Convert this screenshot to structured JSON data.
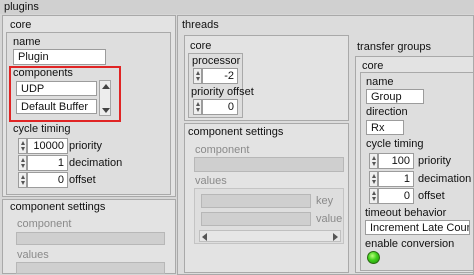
{
  "plugins": {
    "title": "plugins",
    "core": {
      "title": "core",
      "name_label": "name",
      "name_value": "Plugin",
      "components_label": "components",
      "components": [
        "UDP",
        "Default Buffer"
      ],
      "cycle_timing_label": "cycle timing",
      "priority_value": "10000",
      "priority_label": "priority",
      "decimation_value": "1",
      "decimation_label": "decimation",
      "offset_value": "0",
      "offset_label": "offset"
    },
    "component_settings": {
      "title": "component settings",
      "component_label": "component",
      "values_label": "values"
    }
  },
  "threads": {
    "title": "threads",
    "core": {
      "title": "core",
      "processor_label": "processor",
      "processor_value": "-2",
      "priority_offset_label": "priority offset",
      "priority_offset_value": "0"
    },
    "component_settings": {
      "title": "component settings",
      "component_label": "component",
      "values_label": "values",
      "key_label": "key",
      "value_label": "value"
    }
  },
  "transfer_groups": {
    "title": "transfer groups",
    "core": {
      "title": "core",
      "name_label": "name",
      "name_value": "Group",
      "direction_label": "direction",
      "direction_value": "Rx",
      "cycle_timing_label": "cycle timing",
      "priority_value": "100",
      "priority_label": "priority",
      "decimation_value": "1",
      "decimation_label": "decimation",
      "offset_value": "0",
      "offset_label": "offset",
      "timeout_behavior_label": "timeout behavior",
      "timeout_behavior_value": "Increment Late Count",
      "enable_conversion_label": "enable conversion"
    }
  },
  "colors": {
    "highlight": "#e02424",
    "led_on": "#3fcf1a"
  }
}
